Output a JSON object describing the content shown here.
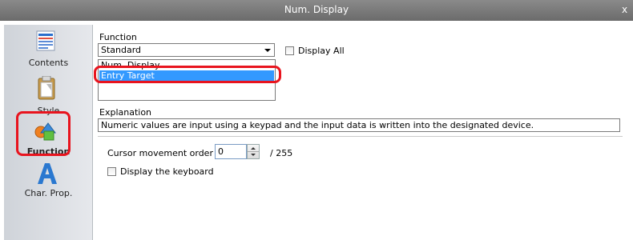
{
  "window": {
    "title": "Num. Display",
    "close_label": "x"
  },
  "sidebar": {
    "items": [
      {
        "label": "Contents"
      },
      {
        "label": "Style"
      },
      {
        "label": "Function"
      },
      {
        "label": "Char. Prop."
      }
    ]
  },
  "function": {
    "label": "Function",
    "selected": "Standard",
    "display_all_label": "Display All"
  },
  "list": {
    "items": [
      {
        "label": "Num. Display",
        "selected": false
      },
      {
        "label": "Entry Target",
        "selected": true
      }
    ]
  },
  "explanation": {
    "label": "Explanation",
    "text": "Numeric values are input using a keypad and the input data is written into the designated device."
  },
  "cursor": {
    "label": "Cursor movement order",
    "value": "0",
    "max": "/ 255"
  },
  "keyboard": {
    "label": "Display the keyboard"
  },
  "colors": {
    "highlight": "#e8141e",
    "selection": "#3399ff"
  }
}
